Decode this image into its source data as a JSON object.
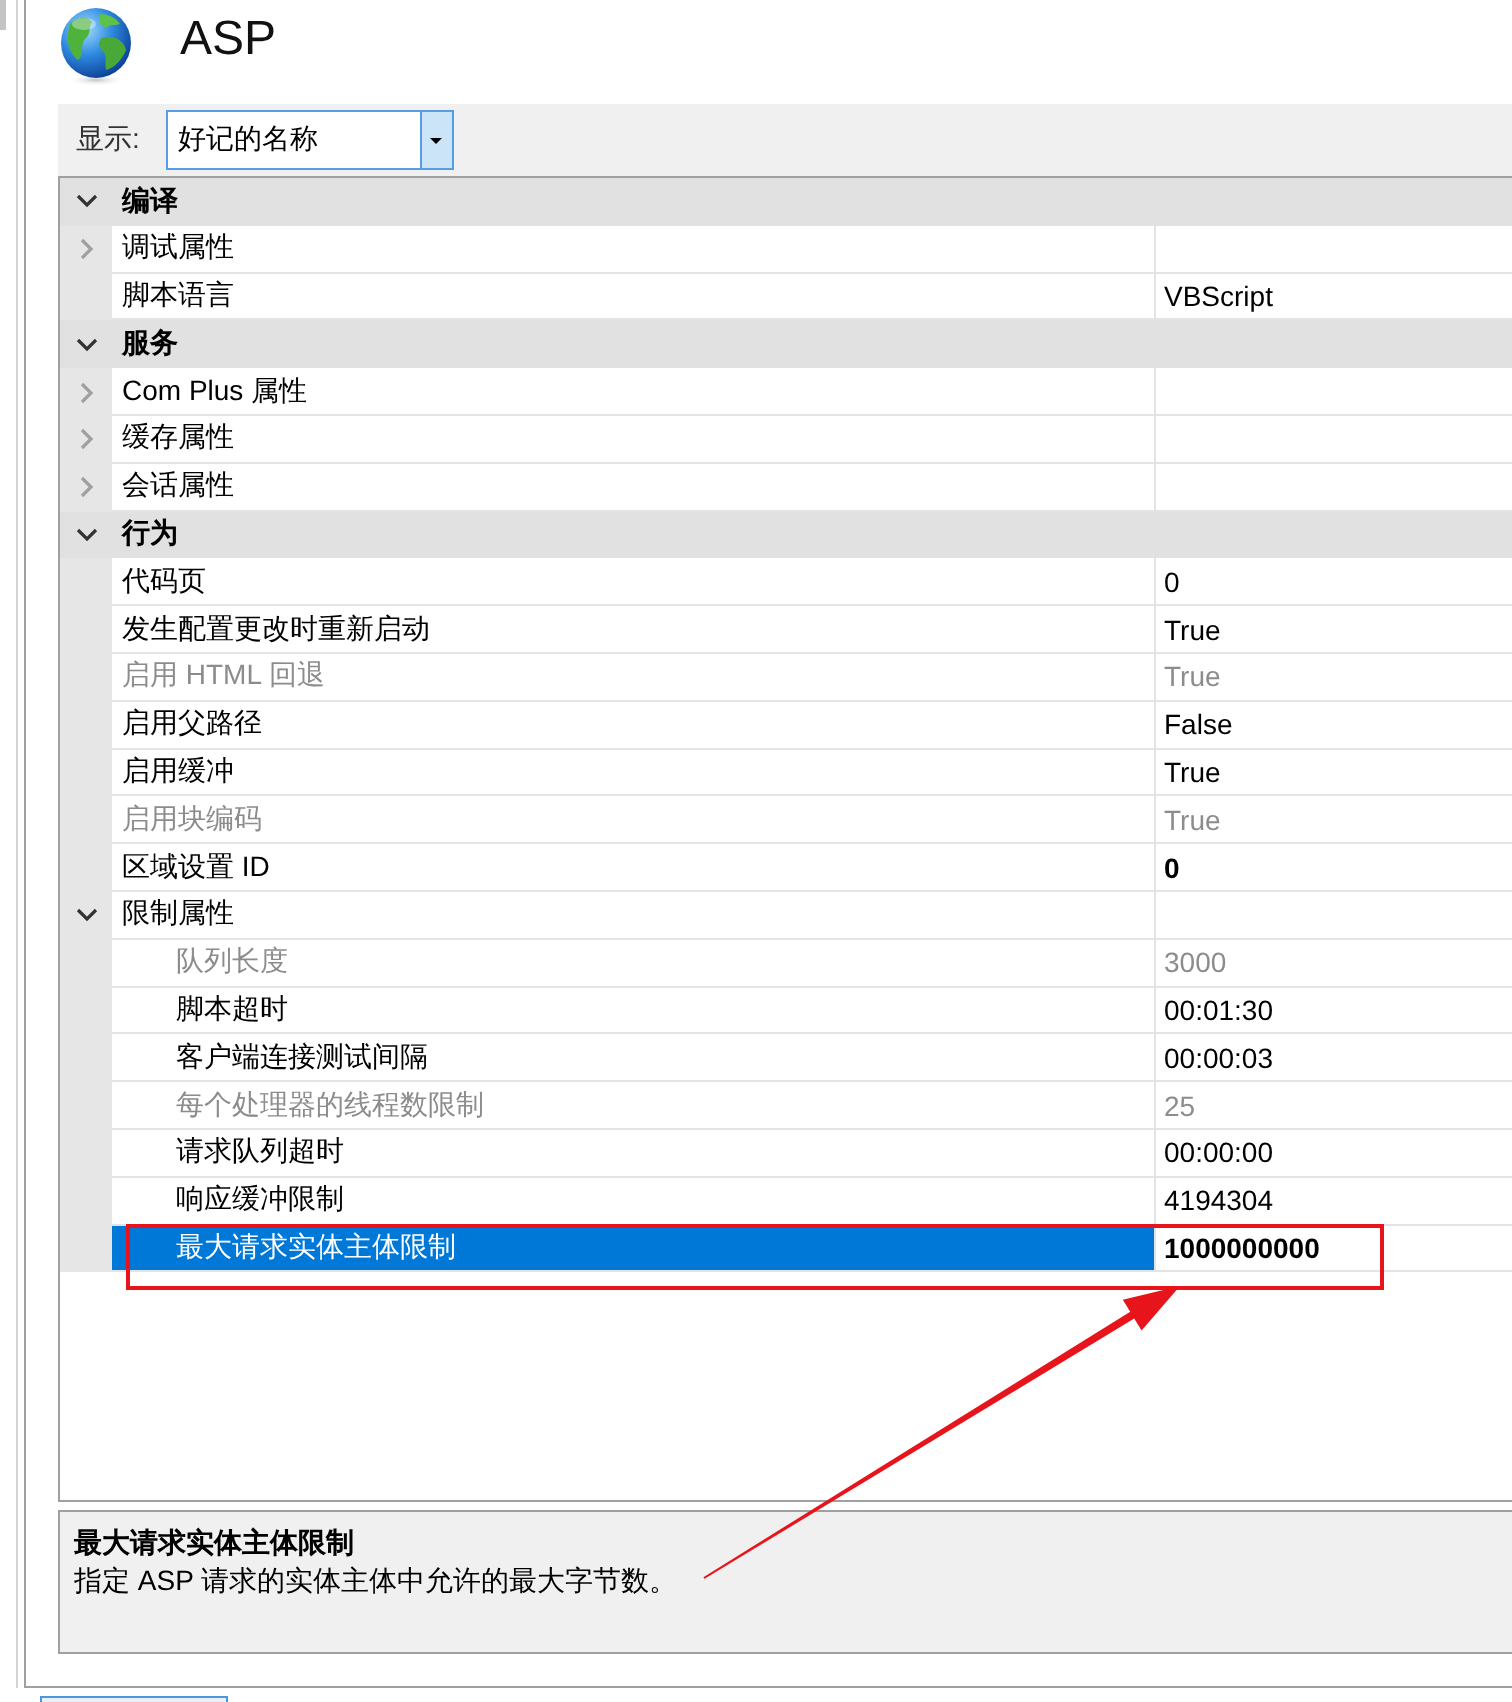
{
  "header": {
    "title": "ASP"
  },
  "filter": {
    "label": "显示:",
    "value": "好记的名称"
  },
  "property_grid": {
    "categories": [
      {
        "name": "编译",
        "expanded": true,
        "selected": false,
        "children": [
          {
            "kind": "group",
            "name": "调试属性",
            "expanded": false,
            "selected": false
          },
          {
            "kind": "property",
            "name": "脚本语言",
            "value": "VBScript",
            "disabled": false,
            "modified": false,
            "selected": false
          }
        ]
      },
      {
        "name": "服务",
        "expanded": true,
        "selected": false,
        "children": [
          {
            "kind": "group",
            "name": "Com Plus 属性",
            "expanded": false,
            "selected": false
          },
          {
            "kind": "group",
            "name": "缓存属性",
            "expanded": false,
            "selected": false
          },
          {
            "kind": "group",
            "name": "会话属性",
            "expanded": false,
            "selected": false
          }
        ]
      },
      {
        "name": "行为",
        "expanded": true,
        "selected": false,
        "children": [
          {
            "kind": "property",
            "name": "代码页",
            "value": "0",
            "disabled": false,
            "modified": false,
            "selected": false
          },
          {
            "kind": "property",
            "name": "发生配置更改时重新启动",
            "value": "True",
            "disabled": false,
            "modified": false,
            "selected": false
          },
          {
            "kind": "property",
            "name": "启用 HTML 回退",
            "value": "True",
            "disabled": true,
            "modified": false,
            "selected": false
          },
          {
            "kind": "property",
            "name": "启用父路径",
            "value": "False",
            "disabled": false,
            "modified": false,
            "selected": false
          },
          {
            "kind": "property",
            "name": "启用缓冲",
            "value": "True",
            "disabled": false,
            "modified": false,
            "selected": false
          },
          {
            "kind": "property",
            "name": "启用块编码",
            "value": "True",
            "disabled": true,
            "modified": false,
            "selected": false
          },
          {
            "kind": "property",
            "name": "区域设置 ID",
            "value": "0",
            "disabled": false,
            "modified": true,
            "selected": false
          },
          {
            "kind": "group",
            "name": "限制属性",
            "expanded": true,
            "selected": false,
            "children": [
              {
                "kind": "property",
                "name": "队列长度",
                "value": "3000",
                "disabled": true,
                "modified": false,
                "selected": false
              },
              {
                "kind": "property",
                "name": "脚本超时",
                "value": "00:01:30",
                "disabled": false,
                "modified": false,
                "selected": false
              },
              {
                "kind": "property",
                "name": "客户端连接测试间隔",
                "value": "00:00:03",
                "disabled": false,
                "modified": false,
                "selected": false
              },
              {
                "kind": "property",
                "name": "每个处理器的线程数限制",
                "value": "25",
                "disabled": true,
                "modified": false,
                "selected": false
              },
              {
                "kind": "property",
                "name": "请求队列超时",
                "value": "00:00:00",
                "disabled": false,
                "modified": false,
                "selected": false
              },
              {
                "kind": "property",
                "name": "响应缓冲限制",
                "value": "4194304",
                "disabled": false,
                "modified": false,
                "selected": false
              },
              {
                "kind": "property",
                "name": "最大请求实体主体限制",
                "value": "1000000000",
                "disabled": false,
                "modified": true,
                "selected": true
              }
            ]
          }
        ]
      }
    ]
  },
  "description": {
    "title": "最大请求实体主体限制",
    "text": "指定 ASP 请求的实体主体中允许的最大字节数。"
  }
}
